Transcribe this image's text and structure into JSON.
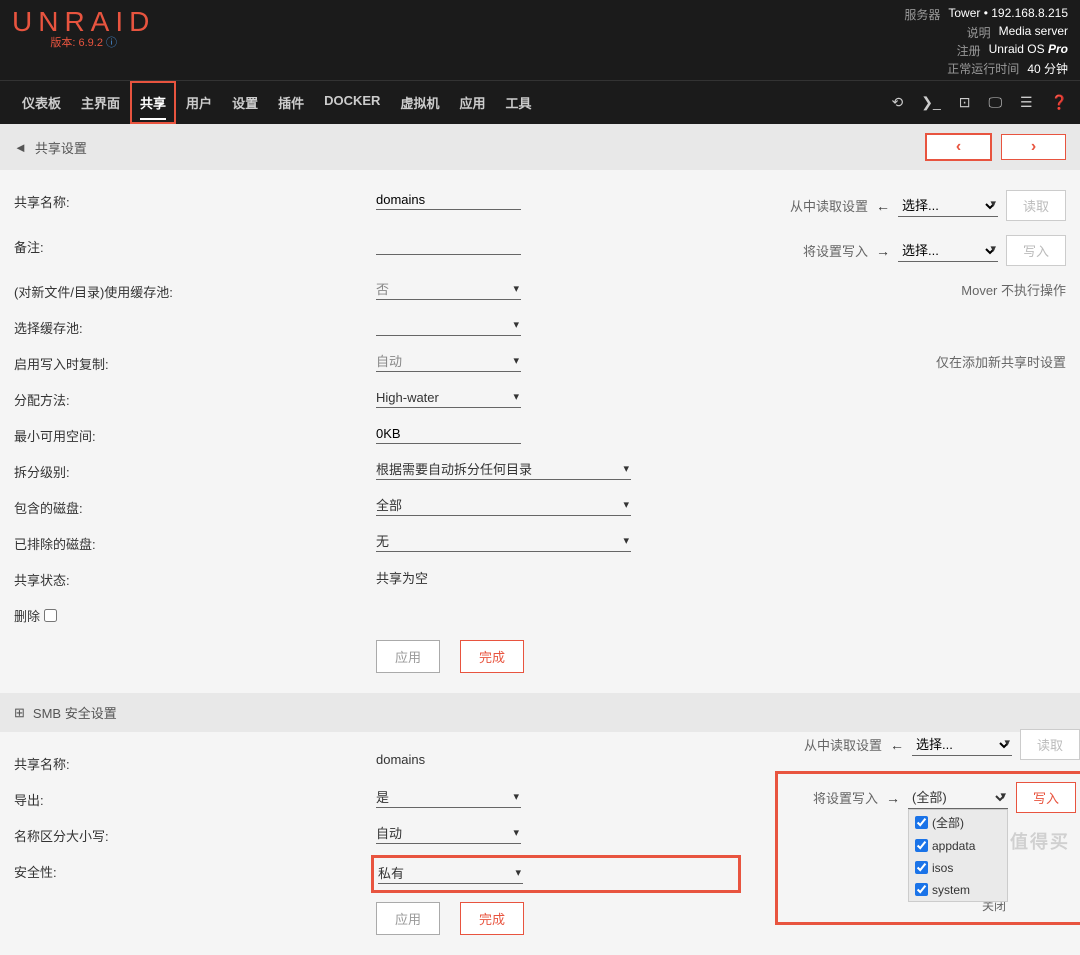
{
  "header": {
    "logo": "UNRAID",
    "version_label": "版本:",
    "version": "6.9.2",
    "server": {
      "label_server": "服务器",
      "server_value": "Tower • 192.168.8.215",
      "label_desc": "说明",
      "desc_value": "Media server",
      "label_reg": "注册",
      "reg_value": "Unraid OS Pro",
      "label_uptime": "正常运行时间",
      "uptime_value": "40 分钟"
    },
    "nav": {
      "items": [
        "仪表板",
        "主界面",
        "共享",
        "用户",
        "设置",
        "插件",
        "DOCKER",
        "虚拟机",
        "应用",
        "工具"
      ],
      "active_index": 2
    }
  },
  "section1": {
    "title": "共享设置",
    "fields": {
      "name_label": "共享名称:",
      "name_value": "domains",
      "comment_label": "备注:",
      "cache_label": "(对新文件/目录)使用缓存池:",
      "cache_value": "否",
      "pool_label": "选择缓存池:",
      "cow_label": "启用写入时复制:",
      "cow_value": "自动",
      "alloc_label": "分配方法:",
      "alloc_value": "High-water",
      "minfree_label": "最小可用空间:",
      "minfree_value": "0KB",
      "split_label": "拆分级别:",
      "split_value": "根据需要自动拆分任何目录",
      "included_label": "包含的磁盘:",
      "included_value": "全部",
      "excluded_label": "已排除的磁盘:",
      "excluded_value": "无",
      "status_label": "共享状态:",
      "status_value": "共享为空",
      "delete_label": "删除"
    },
    "side": {
      "read_from_label": "从中读取设置",
      "read_select": "选择...",
      "read_btn": "读取",
      "write_to_label": "将设置写入",
      "write_select": "选择...",
      "write_btn": "写入",
      "mover_note": "Mover 不执行操作",
      "cow_note": "仅在添加新共享时设置"
    },
    "buttons": {
      "apply": "应用",
      "done": "完成"
    }
  },
  "section2": {
    "title": "SMB 安全设置",
    "fields": {
      "name_label": "共享名称:",
      "name_value": "domains",
      "export_label": "导出:",
      "export_value": "是",
      "case_label": "名称区分大小写:",
      "case_value": "自动",
      "security_label": "安全性:",
      "security_value": "私有"
    },
    "side": {
      "read_from_label": "从中读取设置",
      "read_select": "选择...",
      "read_btn": "读取",
      "write_to_label": "将设置写入",
      "write_select": "(全部)",
      "write_btn": "写入",
      "dropdown_options": [
        "(全部)",
        "appdata",
        "isos",
        "system"
      ],
      "close_text": "关闭"
    },
    "buttons": {
      "apply": "应用",
      "done": "完成"
    }
  }
}
